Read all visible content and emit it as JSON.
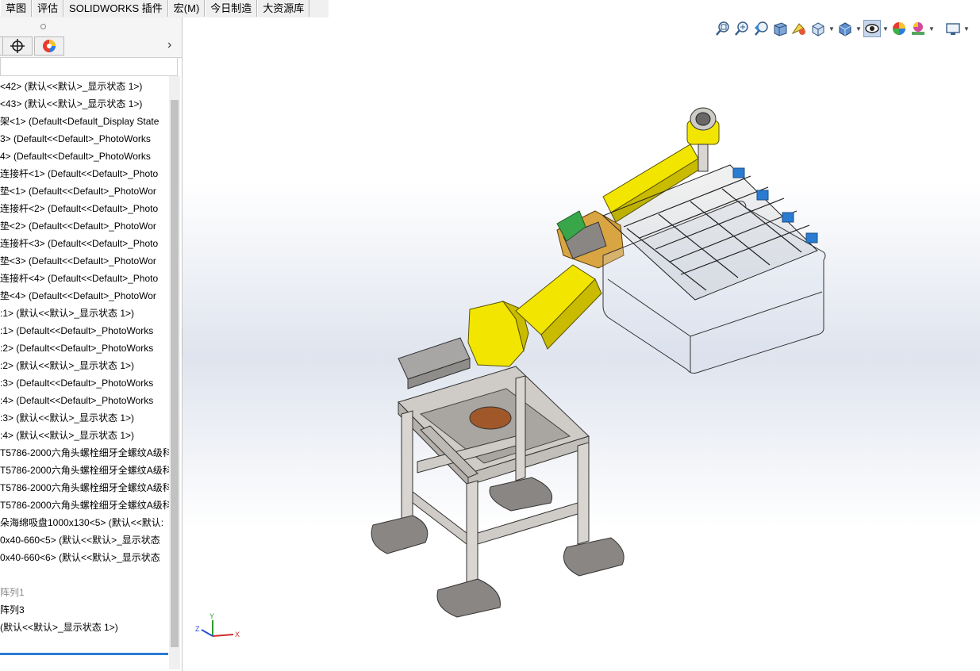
{
  "tabs": [
    "草图",
    "评估",
    "SOLIDWORKS 插件",
    "宏(M)",
    "今日制造",
    "大资源库"
  ],
  "tree": {
    "rows": [
      {
        "text": "<42> (默认<<默认>_显示状态 1>)",
        "dim": false
      },
      {
        "text": "<43> (默认<<默认>_显示状态 1>)",
        "dim": false
      },
      {
        "text": "架<1> (Default<Default_Display State",
        "dim": false
      },
      {
        "text": "3> (Default<<Default>_PhotoWorks",
        "dim": false
      },
      {
        "text": "4> (Default<<Default>_PhotoWorks",
        "dim": false
      },
      {
        "text": "连接杆<1> (Default<<Default>_Photo",
        "dim": false
      },
      {
        "text": "垫<1> (Default<<Default>_PhotoWor",
        "dim": false
      },
      {
        "text": "连接杆<2> (Default<<Default>_Photo",
        "dim": false
      },
      {
        "text": "垫<2> (Default<<Default>_PhotoWor",
        "dim": false
      },
      {
        "text": "连接杆<3> (Default<<Default>_Photo",
        "dim": false
      },
      {
        "text": "垫<3> (Default<<Default>_PhotoWor",
        "dim": false
      },
      {
        "text": "连接杆<4> (Default<<Default>_Photo",
        "dim": false
      },
      {
        "text": "垫<4> (Default<<Default>_PhotoWor",
        "dim": false
      },
      {
        "text": ":1> (默认<<默认>_显示状态 1>)",
        "dim": false
      },
      {
        "text": ":1> (Default<<Default>_PhotoWorks",
        "dim": false
      },
      {
        "text": ":2> (Default<<Default>_PhotoWorks",
        "dim": false
      },
      {
        "text": ":2> (默认<<默认>_显示状态 1>)",
        "dim": false
      },
      {
        "text": ":3> (Default<<Default>_PhotoWorks",
        "dim": false
      },
      {
        "text": ":4> (Default<<Default>_PhotoWorks",
        "dim": false
      },
      {
        "text": ":3> (默认<<默认>_显示状态 1>)",
        "dim": false
      },
      {
        "text": ":4> (默认<<默认>_显示状态 1>)",
        "dim": false
      },
      {
        "text": "T5786-2000六角头螺栓细牙全螺纹A级科",
        "dim": false
      },
      {
        "text": "T5786-2000六角头螺栓细牙全螺纹A级科",
        "dim": false
      },
      {
        "text": "T5786-2000六角头螺栓细牙全螺纹A级科",
        "dim": false
      },
      {
        "text": "T5786-2000六角头螺栓细牙全螺纹A级科",
        "dim": false
      },
      {
        "text": "朵海绵吸盘1000x130<5> (默认<<默认:",
        "dim": false
      },
      {
        "text": "0x40-660<5> (默认<<默认>_显示状态",
        "dim": false
      },
      {
        "text": "0x40-660<6> (默认<<默认>_显示状态",
        "dim": false
      },
      {
        "text": "",
        "dim": false
      },
      {
        "text": "阵列1",
        "dim": true
      },
      {
        "text": "阵列3",
        "dim": false
      },
      {
        "text": "(默认<<默认>_显示状态 1>)",
        "dim": false
      }
    ]
  },
  "hud": {
    "buttons": [
      "zoom-to-fit-icon",
      "zoom-to-area-icon",
      "previous-view-icon",
      "section-view-icon",
      "dynamic-annotation-icon",
      "view-orientation-icon",
      "display-style-icon",
      "hide-show-items-icon",
      "edit-appearance-icon",
      "apply-scene-icon",
      "view-settings-icon"
    ]
  },
  "triad": {
    "x": "X",
    "y": "Y",
    "z": "Z"
  },
  "colors": {
    "robot": "#f2e600",
    "robot_dark": "#c8bb00",
    "frame": "#d7d3cf",
    "feet": "#8a8684",
    "plate": "#a0582a",
    "accent_blue": "#2a7bd2"
  }
}
